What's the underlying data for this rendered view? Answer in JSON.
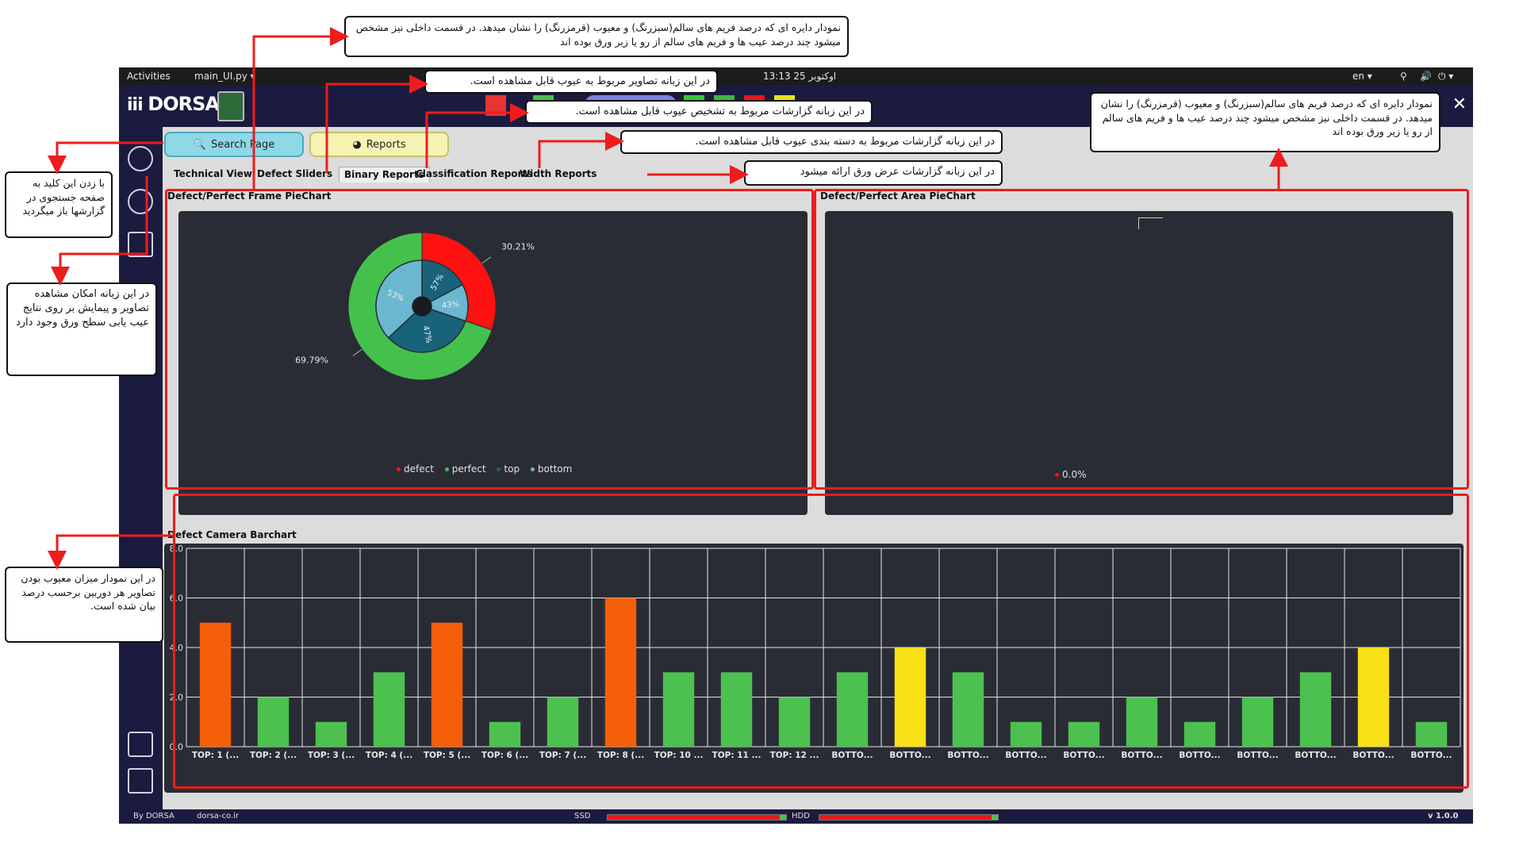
{
  "system_bar": {
    "activities": "Activities",
    "app_menu": "main_UI.py ▾",
    "clock": "13:13  25 اوکتوبر",
    "lang": "en ▾"
  },
  "header": {
    "brand": "DORSA",
    "close": "✕",
    "status_buttons": [
      "#e83434",
      "#4cc14c",
      "#7f7fe0",
      "#35c835",
      "#3fb63f",
      "#e61a1a",
      "#e8e21a"
    ]
  },
  "toolbar": {
    "search_label": "Search Page",
    "reports_label": "Reports"
  },
  "tabs": [
    "Technical View",
    "Defect Sliders",
    "Binary Reports",
    "Classification Reports",
    "Width Reports"
  ],
  "active_tab": "Binary Reports",
  "frame_pie": {
    "title": "Defect/Perfect Frame PieChart",
    "outer": [
      {
        "name": "defect",
        "value": 30.21,
        "label": "30.21%",
        "color": "#ff1111"
      },
      {
        "name": "perfect",
        "value": 69.79,
        "label": "69.79%",
        "color": "#44c14c"
      }
    ],
    "inner_defect": [
      {
        "name": "top",
        "value": 57,
        "label": "57%",
        "color": "#19637a"
      },
      {
        "name": "bottom",
        "value": 43,
        "label": "43%",
        "color": "#6ab7cf"
      }
    ],
    "inner_perfect": [
      {
        "name": "top",
        "value": 47,
        "label": "47%",
        "color": "#19637a"
      },
      {
        "name": "bottom",
        "value": 53,
        "label": "53%",
        "color": "#6ab7cf"
      }
    ],
    "legend": [
      {
        "label": "defect",
        "color": "#ff1111"
      },
      {
        "label": "perfect",
        "color": "#44c14c"
      },
      {
        "label": "top",
        "color": "#19637a"
      },
      {
        "label": "bottom",
        "color": "#6ab7cf"
      }
    ]
  },
  "area_pie": {
    "title": "Defect/Perfect Area PieChart",
    "legend_label": "0.0%",
    "legend_color": "#ff1111"
  },
  "chart_data": {
    "type": "bar",
    "title": "Defect Camera Barchart",
    "categories": [
      "TOP: 1 (...",
      "TOP: 2 (...",
      "TOP: 3 (...",
      "TOP: 4 (...",
      "TOP: 5 (...",
      "TOP: 6 (...",
      "TOP: 7 (...",
      "TOP: 8 (...",
      "TOP: 10 ...",
      "TOP: 11 ...",
      "TOP: 12 ...",
      "BOTTO...",
      "BOTTO...",
      "BOTTO...",
      "BOTTO...",
      "BOTTO...",
      "BOTTO...",
      "BOTTO...",
      "BOTTO...",
      "BOTTO...",
      "BOTTO...",
      "BOTTO...",
      "BOTTO..."
    ],
    "values": [
      5,
      2,
      1,
      3,
      5,
      1,
      2,
      6,
      3,
      3,
      2,
      3,
      4,
      3,
      1,
      1,
      2,
      1,
      2,
      3,
      4,
      1
    ],
    "colors": [
      "#f55f0a",
      "#4cc150",
      "#4cc150",
      "#4cc150",
      "#f55f0a",
      "#4cc150",
      "#4cc150",
      "#f55f0a",
      "#4cc150",
      "#4cc150",
      "#4cc150",
      "#4cc150",
      "#f7e016",
      "#4cc150",
      "#4cc150",
      "#4cc150",
      "#4cc150",
      "#4cc150",
      "#4cc150",
      "#4cc150",
      "#f7e016",
      "#4cc150"
    ],
    "y_ticks": [
      "0.0",
      "2.0",
      "4.0",
      "6.0",
      "8.0"
    ],
    "ylim": [
      0,
      8
    ],
    "grid": true
  },
  "status": {
    "by": "By DORSA",
    "site": "dorsa-co.ir",
    "ssd": "SSD",
    "hdd": "HDD",
    "version": "v 1.0.0"
  },
  "annotations": {
    "frame_pie": "نمودار دایره ای که درصد فریم های سالم(سبزرنگ) و معیوب (قرمزرنگ) را نشان میدهد. در قسمت داخلی نیز مشخص میشود چند درصد عیب ها و فریم های سالم از رو یا زیر ورق بوده اند",
    "images_tab": "در این زبانه تصاویر مربوط به عیوب قابل مشاهده است.",
    "binary_tab": "در این زبانه گزارشات مربوط به تشخیص عیوب قابل مشاهده است.",
    "class_tab": "در این زبانه گزارشات مربوط به دسته بندی عیوب قابل مشاهده است.",
    "width_tab": "در این زبانه گزارشات عرض ورق ارائه میشود",
    "area_pie": "نمودار دایره ای که درصد فریم های سالم(سبزرنگ) و معیوب (قرمزرنگ) را نشان میدهد. در قسمت داخلی نیز مشخص میشود چند درصد عیب ها و فریم های سالم از رو یا زیر ورق بوده اند",
    "search": "با زدن این کلید به صفحه جستجوی در گزارشها باز میگردید",
    "technical": "در این زبانه امکان مشاهده تصاویر و پیمایش بر روی نتایج عیب یابی سطح ورق وجود دارد",
    "barchart": "در این نمودار میزان معیوب بودن تصاویر هر دوربین برحسب درصد بیان شده است."
  }
}
